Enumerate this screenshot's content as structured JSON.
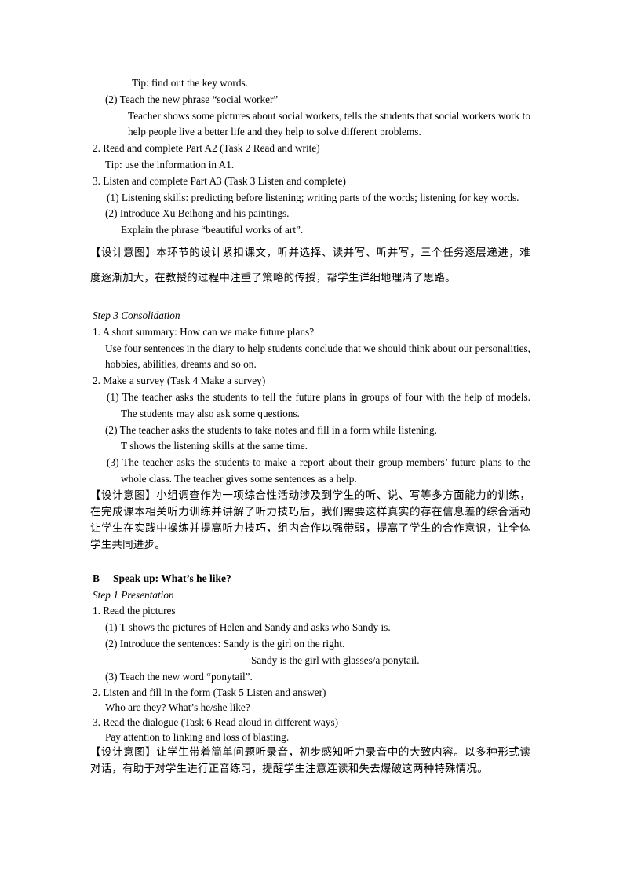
{
  "document": {
    "section_a_continued": {
      "tip_key_words": "Tip: find out the key words.",
      "item_2_teach_phrase": "(2) Teach the new phrase “social worker”",
      "item_2_detail": "Teacher shows some pictures about social workers, tells the students that social workers work to help people live a better life and they help to solve different problems.",
      "step_2_read": "2. Read and complete Part A2 (Task 2 Read and write)",
      "step_2_tip": "Tip: use the information in A1.",
      "step_3_listen": "3. Listen and complete Part A3 (Task 3 Listen and complete)",
      "step_3_sub1": "(1) Listening skills: predicting before listening; writing parts of the words; listening for key words.",
      "step_3_sub2": "(2) Introduce Xu Beihong and his paintings.",
      "step_3_sub2_detail": "Explain the phrase “beautiful works of art”.",
      "design_intent_1": "【设计意图】本环节的设计紧扣课文，听并选择、读并写、听并写，三个任务逐层递进，难度逐渐加大，在教授的过程中注重了策略的传授，帮学生详细地理清了思路。"
    },
    "step3_consolidation": {
      "title": "Step 3 Consolidation",
      "item1": "1. A short summary: How can we make future plans?",
      "item1_detail": "Use four sentences in the diary to help students conclude that we should think about our personalities, hobbies, abilities, dreams and so on.",
      "item2": "2. Make a survey (Task 4 Make a survey)",
      "item2_sub1": "(1) The teacher asks the students to tell the future plans in groups of four with the help of models. The students may also ask some questions.",
      "item2_sub2": "(2) The teacher asks the students to take notes and fill in a form while listening.",
      "item2_sub2_detail": "T shows the listening skills at the same time.",
      "item2_sub3": "(3) The teacher asks the students to make a report about their group members’ future plans to the whole class. The teacher gives some sentences as a help.",
      "design_intent_2": "【设计意图】小组调查作为一项综合性活动涉及到学生的听、说、写等多方面能力的训练，在完成课本相关听力训练并讲解了听力技巧后，我们需要这样真实的存在信息差的综合活动让学生在实践中操练并提高听力技巧，组内合作以强带弱，提高了学生的合作意识，让全体学生共同进步。"
    },
    "section_b": {
      "letter": "B",
      "title": "Speak up: What’s he like?",
      "step1_title": "Step 1 Presentation",
      "item1": "1. Read the pictures",
      "item1_sub1": "(1) T shows the pictures of Helen and Sandy and asks who Sandy is.",
      "item1_sub2": "(2) Introduce the sentences: Sandy is the girl on the right.",
      "item1_sub2_cont": "Sandy is the girl with glasses/a ponytail.",
      "item1_sub3": "(3) Teach the new word “ponytail”.",
      "item2": "2. Listen and fill in the form (Task 5 Listen and answer)",
      "item2_detail": "Who are they? What’s he/she like?",
      "item3": "3. Read the dialogue (Task 6 Read aloud in different ways)",
      "item3_detail": "Pay attention to linking and loss of blasting.",
      "design_intent_3": "【设计意图】让学生带着简单问题听录音，初步感知听力录音中的大致内容。以多种形式读对话，有助于对学生进行正音练习，提醒学生注意连读和失去爆破这两种特殊情况。"
    }
  }
}
